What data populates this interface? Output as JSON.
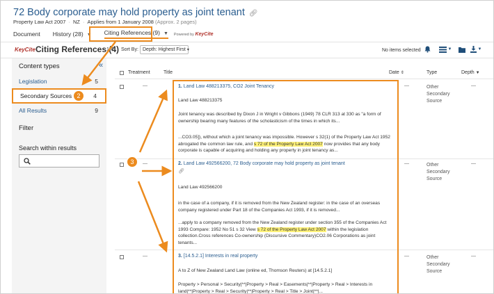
{
  "header": {
    "title": "72 Body corporate may hold property as joint tenant",
    "meta_act": "Property Law Act 2007",
    "meta_jurisdiction": "NZ",
    "meta_applies": "Applies from 1 January 2008",
    "meta_pages": "(Approx. 2 pages)"
  },
  "tabs": {
    "document": "Document",
    "history": "History (28)",
    "citing": "Citing References (9)",
    "powered_by": "Powered by",
    "powered_brand": "KeyCite"
  },
  "toolbar": {
    "logo": "KeyCite",
    "title": "Citing References (4)",
    "range": "1-4",
    "sort_label": "Sort By:",
    "sort_value": "Depth: Highest First",
    "selected": "No items selected"
  },
  "sidebar": {
    "content_types": "Content types",
    "items": [
      {
        "label": "Legislation",
        "count": "5"
      },
      {
        "label": "Secondary Sources",
        "count": "4"
      },
      {
        "label": "All Results",
        "count": "9"
      }
    ],
    "filter": "Filter",
    "search_heading": "Search within results",
    "search_placeholder": ""
  },
  "table": {
    "headers": {
      "treatment": "Treatment",
      "title": "Title",
      "date": "Date",
      "type": "Type",
      "depth": "Depth"
    },
    "rows": [
      {
        "num": "1.",
        "title": "Land Law 488213375, CO2 Joint Tenancy",
        "subtitle": "Land Law 488213375",
        "treatment": "—",
        "date": "—",
        "depth": "—",
        "type_lines": [
          "Other",
          "Secondary",
          "Source"
        ],
        "snip1": "Joint tenancy was described by Dixon J in Wright v Gibbons (1949) 78 CLR 313 at 330 as \"a form of ownership bearing many features of the scholasticism of the times in which its...",
        "snip2_pre": "...CO3.05]), without which a joint tenancy was impossible. However s 32(1) of the Property Law Act 1952 abrogated the common law rule, and",
        "snip2_hl": "s 72 of the Property Law Act 2007",
        "snip2_post": "now provides that any body corporate is capable of acquiring and holding any property in joint tenancy as..."
      },
      {
        "num": "2.",
        "title": "Land Law 492566200, 72 Body corporate may hold property as joint tenant",
        "subtitle": "Land Law 492566200",
        "treatment": "—",
        "date": "—",
        "depth": "—",
        "type_lines": [
          "Other",
          "Secondary",
          "Source"
        ],
        "snip1": "in the case of a company, if it is removed from the New Zealand register: in the case of an overseas company registered under Part 18 of the Companies Act 1993, if it is removed...",
        "snip2_pre": "...apply to a company removed from the New Zealand register under section 355 of the Companies Act 1993 Compare: 1952 No 51 s 32 View",
        "snip2_hl": "s 72 of the Property Law Act 2007",
        "snip2_post": "within the legislation collection.Cross references Co-ownership (Discursive Commentary)CO2.06 Corporations as joint tenants..."
      },
      {
        "num": "3.",
        "title": "[14.5.2.1] Interests in real property",
        "subtitle": "A to Z of New Zealand Land Law (online ed, Thomson Reuters) at [14.5.2.1]",
        "treatment": "—",
        "date": "—",
        "depth": "—",
        "type_lines": [
          "Other",
          "Secondary",
          "Source"
        ],
        "snip1": "Property > Personal > Security|**|Property > Real > Easements|**|Property > Real > Interests in land|**|Property > Real > Security|**|Property > Real > Title > Joint|**|..."
      }
    ]
  },
  "annotations": {
    "badge2": "2",
    "badge3": "3"
  },
  "colors": {
    "accent": "#ec8b1e",
    "link": "#2a5d8f",
    "brand": "#b0322b",
    "highlight": "#fff27a"
  }
}
